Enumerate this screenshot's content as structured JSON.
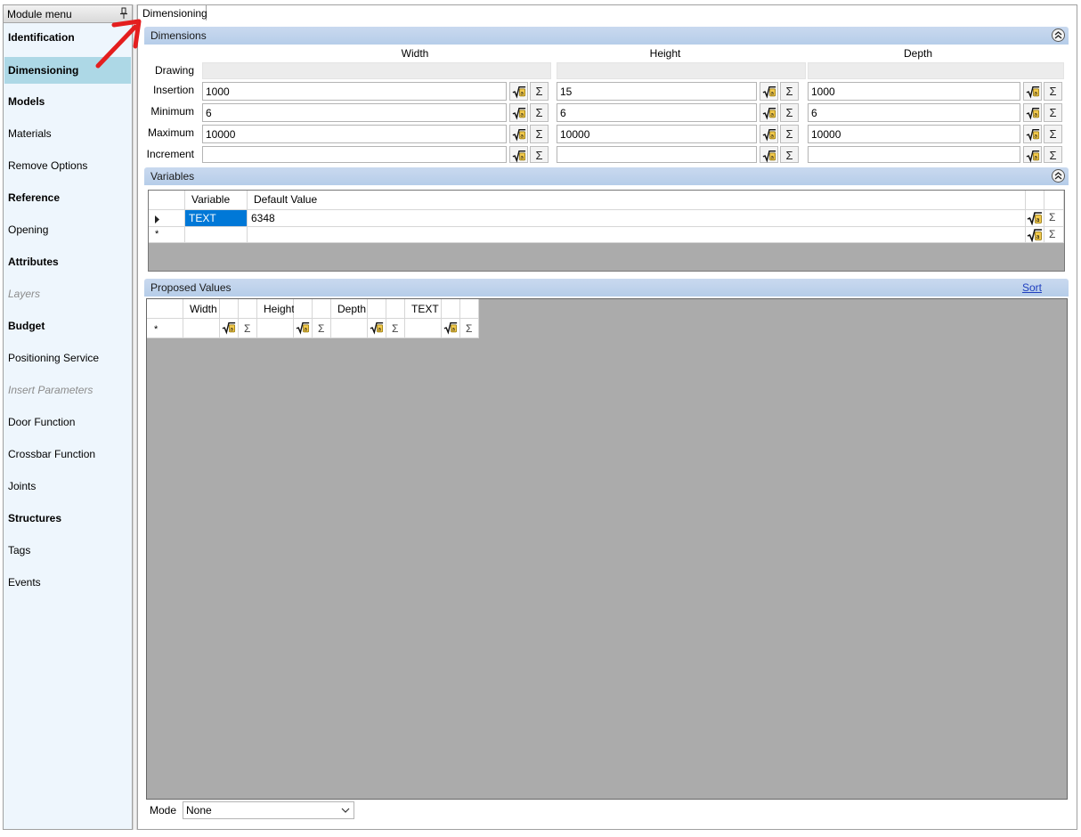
{
  "sidebar": {
    "title": "Module menu",
    "items": [
      {
        "label": "Identification",
        "style": "bold"
      },
      {
        "label": "Dimensioning",
        "style": "bold",
        "selected": true
      },
      {
        "label": "Models",
        "style": "bold"
      },
      {
        "label": "Materials",
        "style": "normal"
      },
      {
        "label": "Remove Options",
        "style": "normal"
      },
      {
        "label": "Reference",
        "style": "bold"
      },
      {
        "label": "Opening",
        "style": "normal"
      },
      {
        "label": "Attributes",
        "style": "bold"
      },
      {
        "label": "Layers",
        "style": "disabled"
      },
      {
        "label": "Budget",
        "style": "bold"
      },
      {
        "label": "Positioning Service",
        "style": "normal"
      },
      {
        "label": "Insert Parameters",
        "style": "disabled"
      },
      {
        "label": "Door Function",
        "style": "normal"
      },
      {
        "label": "Crossbar Function",
        "style": "normal"
      },
      {
        "label": "Joints",
        "style": "normal"
      },
      {
        "label": "Structures",
        "style": "bold"
      },
      {
        "label": "Tags",
        "style": "normal"
      },
      {
        "label": "Events",
        "style": "normal"
      }
    ]
  },
  "tabs": {
    "active": "Dimensioning"
  },
  "dimensions": {
    "title": "Dimensions",
    "columns": [
      "Width",
      "Height",
      "Depth"
    ],
    "rows": [
      {
        "label": "Drawing",
        "values": [
          "",
          "",
          ""
        ]
      },
      {
        "label": "Insertion",
        "values": [
          "1000",
          "15",
          "1000"
        ]
      },
      {
        "label": "Minimum",
        "values": [
          "6",
          "6",
          "6"
        ]
      },
      {
        "label": "Maximum",
        "values": [
          "10000",
          "10000",
          "10000"
        ]
      },
      {
        "label": "Increment",
        "values": [
          "",
          "",
          ""
        ]
      }
    ]
  },
  "variables": {
    "title": "Variables",
    "headers": {
      "variable": "Variable",
      "default_value": "Default Value"
    },
    "rows": [
      {
        "variable": "TEXT",
        "default_value": "6348"
      }
    ],
    "new_row_marker": "*"
  },
  "proposed": {
    "title": "Proposed Values",
    "sort_label": "Sort",
    "columns": [
      "Width",
      "Height",
      "Depth",
      "TEXT"
    ],
    "new_row_marker": "*"
  },
  "mode": {
    "label": "Mode",
    "selected": "None"
  },
  "icons": {
    "sum": "Σ",
    "formula": "fx-sqrt-icon"
  },
  "colors": {
    "selected_item": "#add8e6",
    "group_header": "#b6cde9",
    "selected_cell": "#0078d7",
    "grid_background": "#ababab",
    "annotation_arrow": "#e41e1e"
  }
}
